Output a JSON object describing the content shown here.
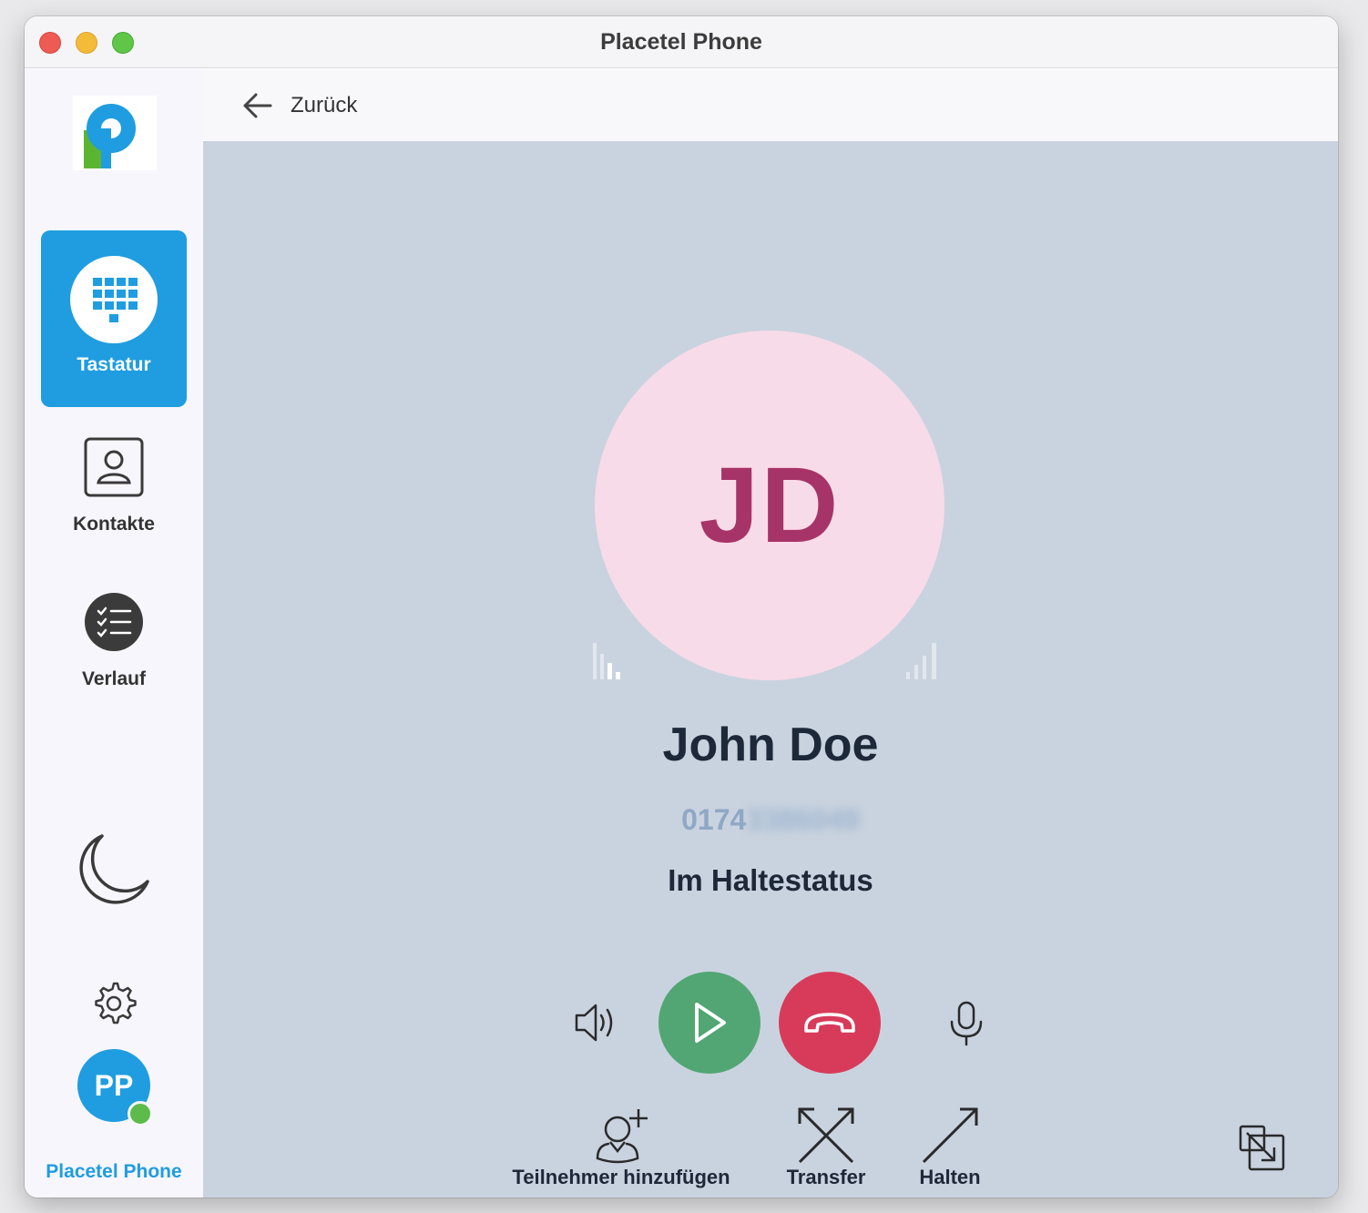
{
  "window": {
    "title": "Placetel Phone"
  },
  "sidebar": {
    "items": [
      {
        "label": "Tastatur",
        "icon": "dialpad-icon",
        "active": true
      },
      {
        "label": "Kontakte",
        "icon": "contacts-icon",
        "active": false
      },
      {
        "label": "Verlauf",
        "icon": "history-icon",
        "active": false
      }
    ],
    "profile": {
      "initials": "PP",
      "name": "Placetel Phone",
      "status": "online"
    }
  },
  "topbar": {
    "back_label": "Zurück"
  },
  "call": {
    "initials": "JD",
    "name": "John Doe",
    "number_visible": "0174",
    "number_hidden": "3386049",
    "status": "Im Haltestatus"
  },
  "actions": {
    "add_participant": "Teilnehmer hinzufügen",
    "transfer": "Transfer",
    "hold": "Halten"
  },
  "colors": {
    "accent": "#1f9de0",
    "resume": "#52a673",
    "hangup": "#d83b5a",
    "avatar_bg": "#f8dbe8",
    "avatar_fg": "#a73468"
  }
}
